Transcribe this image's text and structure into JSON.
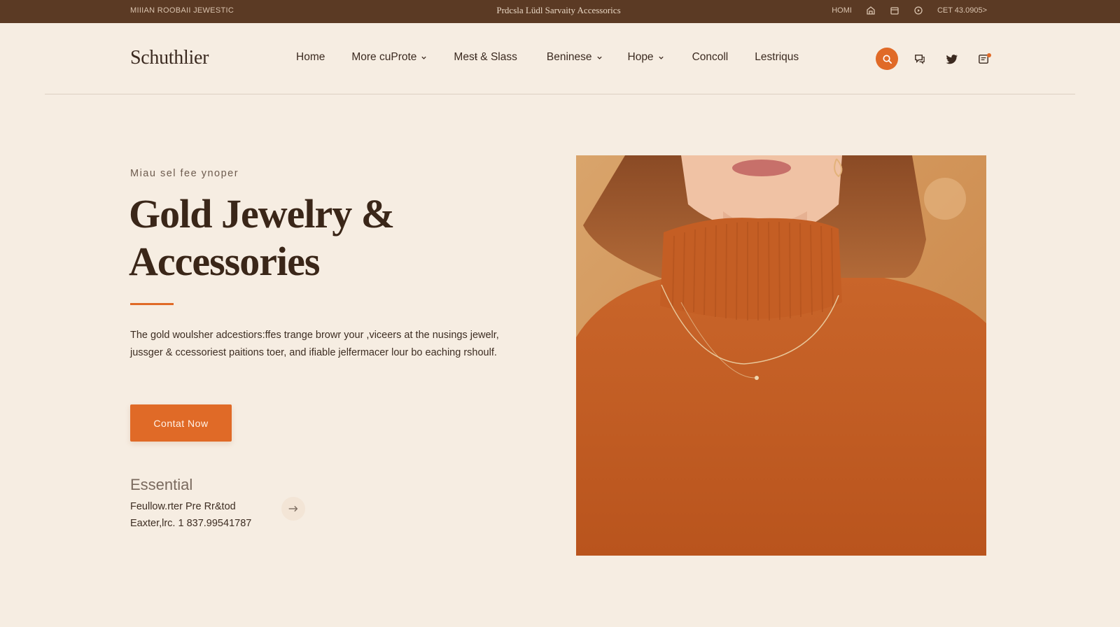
{
  "topbar": {
    "left_text": "MIIIAN ROOBAII JEWESTIC",
    "center_text": "Prdcsla Lüdl Sarvaity Accessorics",
    "right_label": "HOMI",
    "phone": "CET 43.0905>",
    "icons": [
      "store-icon",
      "calendar-icon",
      "clock-icon"
    ]
  },
  "header": {
    "logo": "Schuthlier",
    "nav": [
      {
        "label": "Home",
        "dropdown": false
      },
      {
        "label": "More cuProte",
        "dropdown": true
      },
      {
        "label": "Mesŧ & Slass",
        "dropdown": false
      },
      {
        "label": "Beninese",
        "dropdown": true
      },
      {
        "label": "Hope",
        "dropdown": true
      },
      {
        "label": "Concoll",
        "dropdown": false
      },
      {
        "label": "Lestriqus",
        "dropdown": false
      }
    ],
    "icons": [
      "search-icon",
      "chat-icon",
      "twitter-icon",
      "cart-icon"
    ]
  },
  "hero": {
    "eyebrow": "Miau sel fee ynoper",
    "title_line1": "Gold Jewelry &",
    "title_line2": "Accessories",
    "description": "The gold woulsher adcestiors:ffes trange browr your ,viceers at the nusings jewelr, jussger & ccessoriest paitions toer, and ifiable jelfermacer lour bo eaching rshoulf.",
    "cta_label": "Contat Now",
    "essential_label": "Essential",
    "contact_line1": "Feullow.rter Pre Rr&tod",
    "contact_line2": "Eaxter,lrc.  1 837.99541787",
    "image_alt": "Woman in orange turtleneck sweater wearing a gold necklace"
  },
  "colors": {
    "background": "#f6ede2",
    "topbar": "#5b3a24",
    "accent": "#e06a27",
    "text": "#3b2a20"
  }
}
